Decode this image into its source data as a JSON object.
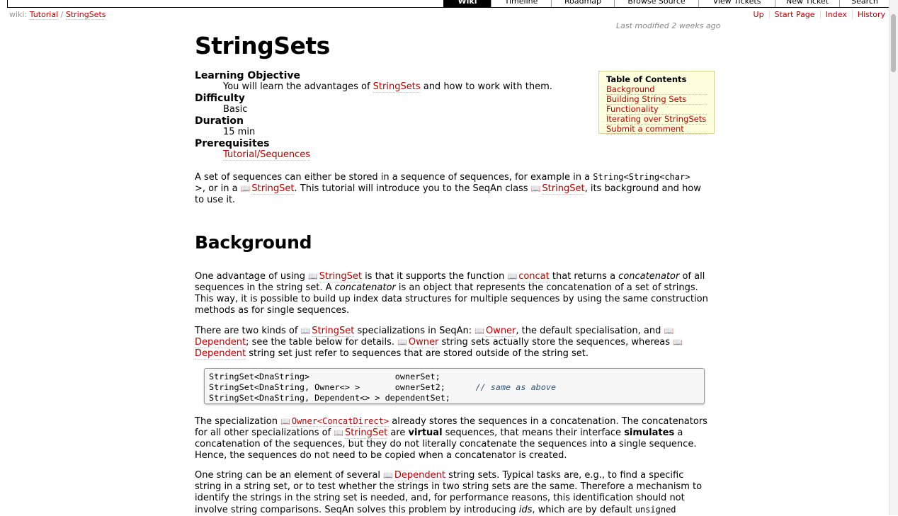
{
  "mainnav": [
    "Wiki",
    "Timeline",
    "Roadmap",
    "Browse Source",
    "View Tickets",
    "New Ticket",
    "Search"
  ],
  "breadcrumb": {
    "prefix": "wiki:",
    "items": [
      "Tutorial",
      "StringSets"
    ],
    "sep": "/"
  },
  "ctxtnav": [
    "Up",
    "Start Page",
    "Index",
    "History"
  ],
  "last_modified": "Last modified 2 weeks ago",
  "title": "StringSets",
  "meta": {
    "lo_label": "Learning Objective",
    "lo_a": "You will learn the advantages of ",
    "lo_link": "StringSets",
    "lo_b": " and how to work with them.",
    "diff_label": "Difficulty",
    "diff_value": "Basic",
    "dur_label": "Duration",
    "dur_value": "15 min",
    "pre_label": "Prerequisites",
    "pre_value": "Tutorial/Sequences"
  },
  "toc": {
    "heading": "Table of Contents",
    "items": [
      "Background",
      "Building String Sets",
      "Functionality",
      "Iterating over StringSets",
      "Submit a comment"
    ]
  },
  "intro": {
    "t1": "A set of sequences can either be stored in a sequence of sequences, for example in a ",
    "c1": "String<String<char>",
    "t2": ">, or in a ",
    "l1": "StringSet",
    "t3": ". This tutorial will introduce you to the SeqAn class ",
    "l2": "StringSet",
    "t4": ", its background and how to use it."
  },
  "h_background": "Background",
  "p1": {
    "t1": "One advantage of using ",
    "l1": "StringSet",
    "t2": " is that it supports the function ",
    "l2": "concat",
    "t3": " that returns a ",
    "e1": "concatenator",
    "t4": " of all sequences in the string set. A ",
    "e2": "concatenator",
    "t5": " is an object that represents the concatenation of a set of strings. This way, it is possible to build up index data structures for multiple sequences by using the same construction methods as for single sequences."
  },
  "p2": {
    "t1": "There are two kinds of ",
    "l1": "StringSet",
    "t2": " specializations in SeqAn: ",
    "l2": "Owner",
    "t3": ", the default specialisation, and ",
    "l3": "Dependent",
    "t4": "; see the table below for details. ",
    "l4": "Owner",
    "t5": " string sets actually store the sequences, whereas ",
    "l5": "Dependent",
    "t6": " string set just refer to sequences that are stored outside of the string set."
  },
  "code": {
    "l1a": "StringSet<DnaString>                 ownerSet;",
    "l2a": "StringSet<DnaString, Owner<> >       ownerSet2;      ",
    "l2c": "// same as above",
    "l3a": "StringSet<DnaString, Dependent<> > dependentSet;"
  },
  "p3": {
    "t1": "The specialization ",
    "l1": "Owner<ConcatDirect>",
    "t2": " already stores the sequences in a concatenation. The concatenators for all other specializations of ",
    "l2": "StringSet",
    "t3": " are ",
    "b1": "virtual",
    "t4": " sequences, that means their interface ",
    "b2": "simulates",
    "t5": " a concatenation of the sequences, but they do not literally concatenate the sequences into a single sequence. Hence, the sequences do not need to be copied when a concatenator is created."
  },
  "p4": {
    "t1": "One string can be an element of several ",
    "l1": "Dependent",
    "t2": " string sets. Typical tasks are, e.g., to find a specific string in a string set, or to test whether the strings in two string sets are the same. Therefore a mechanism to identify the strings in the string set is needed, and, for performance reasons, this identification should not involve string comparisons. SeqAn solves this problem by introducing ",
    "e1": "ids",
    "t3": ", which are by default ",
    "c1": "unsigned"
  }
}
